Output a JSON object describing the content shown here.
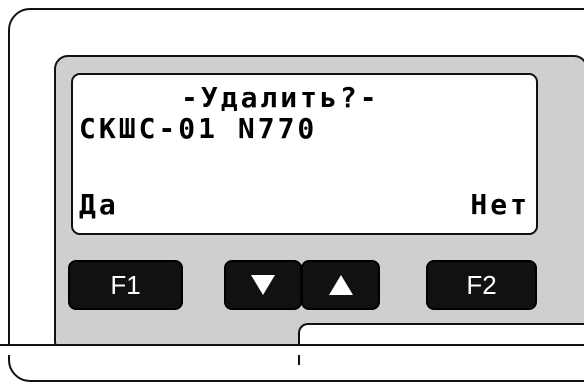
{
  "display": {
    "title": "-Удалить?-",
    "device": "СКШС-01 N770",
    "left_option": "Да",
    "right_option": "Нет"
  },
  "keys": {
    "f1_label": "F1",
    "f2_label": "F2",
    "down_icon": "triangle-down",
    "up_icon": "triangle-up"
  },
  "colors": {
    "panel": "#cfcfcf",
    "key": "#111111",
    "screen": "#ffffff"
  }
}
